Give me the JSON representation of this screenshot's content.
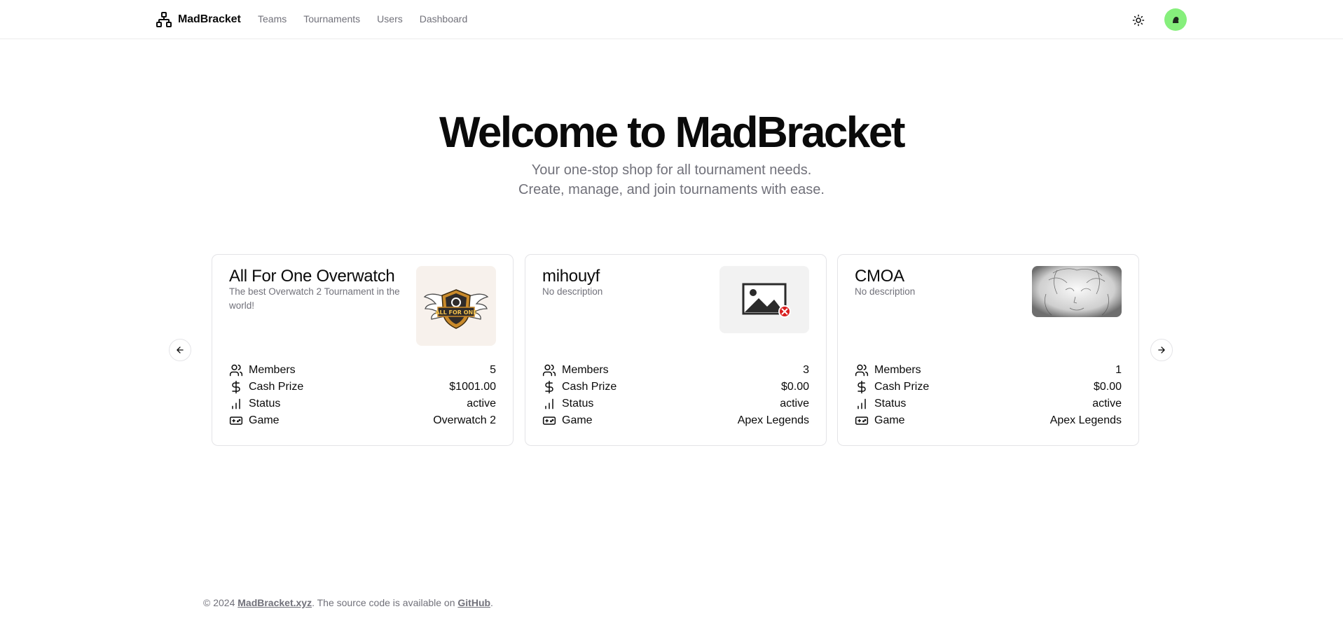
{
  "header": {
    "brand": "MadBracket",
    "nav": [
      "Teams",
      "Tournaments",
      "Users",
      "Dashboard"
    ],
    "avatar_color": "#86ef7c"
  },
  "hero": {
    "title": "Welcome to MadBracket",
    "subtitle_line1": "Your one-stop shop for all tournament needs.",
    "subtitle_line2": "Create, manage, and join tournaments with ease."
  },
  "stat_labels": {
    "members": "Members",
    "cash": "Cash Prize",
    "status": "Status",
    "game": "Game"
  },
  "cards": [
    {
      "name": "All For One Overwatch",
      "description": "The best Overwatch 2 Tournament in the world!",
      "members": "5",
      "cash_prize": "$1001.00",
      "status": "active",
      "game": "Overwatch 2",
      "logo_text": "ALL FOR ONE"
    },
    {
      "name": "mihouyf",
      "description": "No description",
      "members": "3",
      "cash_prize": "$0.00",
      "status": "active",
      "game": "Apex Legends"
    },
    {
      "name": "CMOA",
      "description": "No description",
      "members": "1",
      "cash_prize": "$0.00",
      "status": "active",
      "game": "Apex Legends"
    }
  ],
  "footer": {
    "prefix": "© 2024 ",
    "site_link": "MadBracket.xyz",
    "middle": ". The source code is available on ",
    "github_link": "GitHub",
    "suffix": "."
  }
}
